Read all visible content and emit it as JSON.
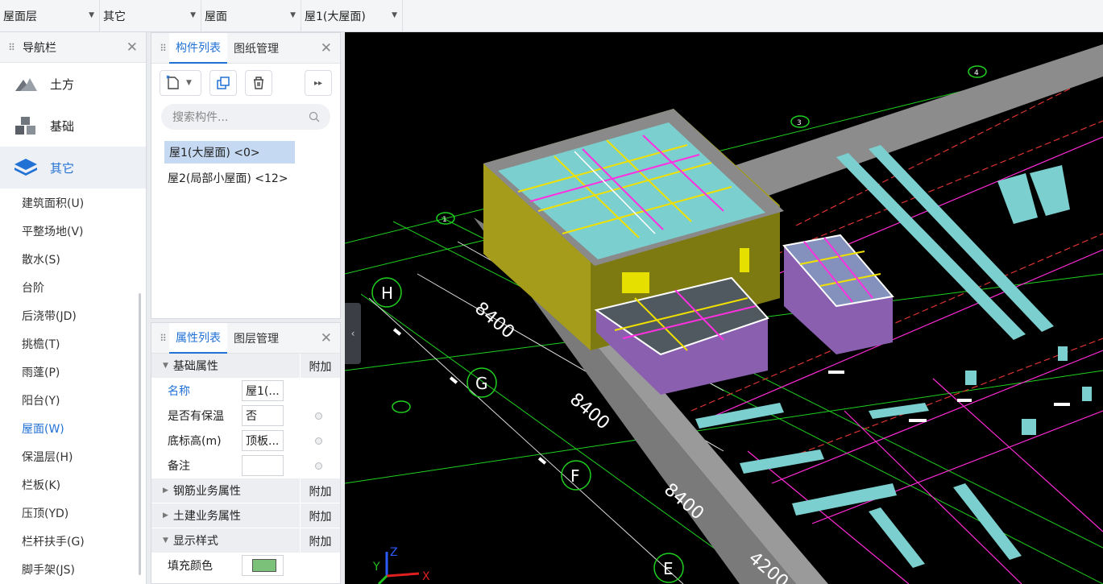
{
  "topbar": {
    "floor": "屋面层",
    "type": "其它",
    "element": "屋面",
    "item": "屋1(大屋面)"
  },
  "nav": {
    "title": "导航栏",
    "big": [
      {
        "label": "土方",
        "icon": "terrain-icon"
      },
      {
        "label": "基础",
        "icon": "foundation-icon"
      },
      {
        "label": "其它",
        "icon": "layers-icon"
      }
    ],
    "items": [
      "建筑面积(U)",
      "平整场地(V)",
      "散水(S)",
      "台阶",
      "后浇带(JD)",
      "挑檐(T)",
      "雨蓬(P)",
      "阳台(Y)",
      "屋面(W)",
      "保温层(H)",
      "栏板(K)",
      "压顶(YD)",
      "栏杆扶手(G)",
      "脚手架(JS)"
    ]
  },
  "components": {
    "tab_active": "构件列表",
    "tab_other": "图纸管理",
    "search_placeholder": "搜索构件...",
    "items": [
      "屋1(大屋面) <0>",
      "屋2(局部小屋面) <12>"
    ]
  },
  "properties": {
    "tab_active": "属性列表",
    "tab_other": "图层管理",
    "group_basic": "基础属性",
    "add": "附加",
    "rows": [
      {
        "name": "名称",
        "value": "屋1(..."
      },
      {
        "name": "是否有保温",
        "value": "否"
      },
      {
        "name": "底标高(m)",
        "value": "顶板..."
      },
      {
        "name": "备注",
        "value": ""
      }
    ],
    "group_rebar": "钢筋业务属性",
    "group_civil": "土建业务属性",
    "group_style": "显示样式",
    "fill_color_label": "填充颜色",
    "fill_color": "#7cc17a"
  },
  "viewport": {
    "dims": [
      "8400",
      "8400",
      "8400",
      "4200"
    ],
    "axes": [
      "H",
      "G",
      "F",
      "E"
    ],
    "axis_circles": [
      "1",
      "2",
      "3",
      "4"
    ],
    "gizmo": {
      "x": "X",
      "y": "Y",
      "z": "Z"
    }
  }
}
